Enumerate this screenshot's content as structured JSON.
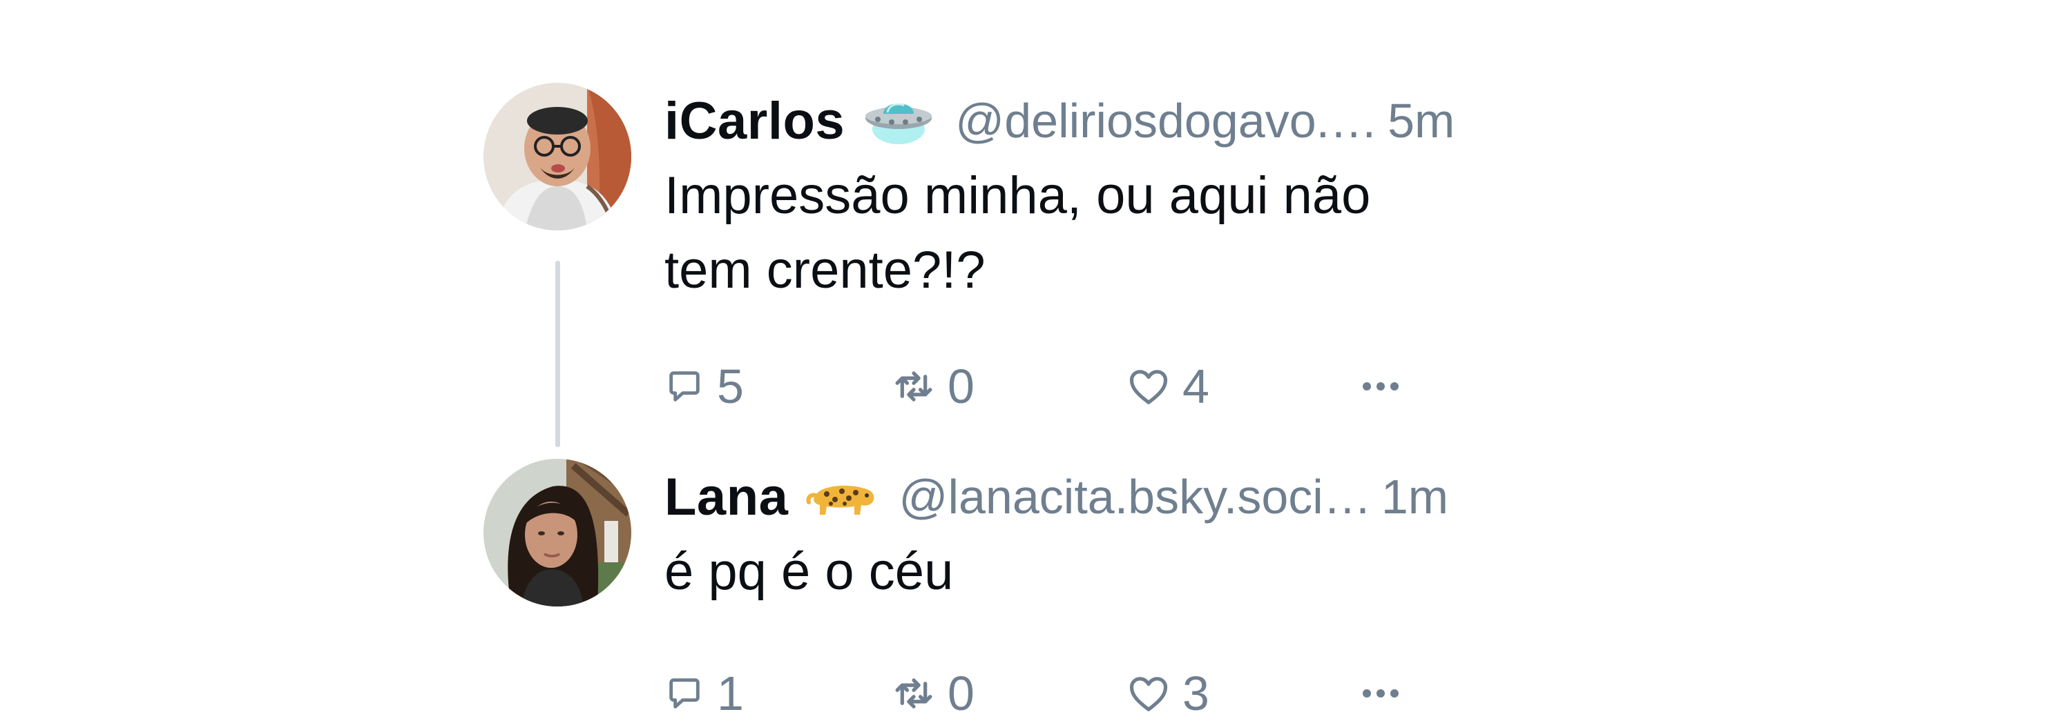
{
  "posts": [
    {
      "display_name": "iCarlos",
      "name_emoji": "flying-saucer-emoji",
      "handle": "@deliriosdogavo.…",
      "separator": "",
      "time": "5m",
      "text_lines": [
        "Impressão minha, ou aqui não",
        "tem crente?!?"
      ],
      "reply_count": "5",
      "repost_count": "0",
      "like_count": "4"
    },
    {
      "display_name": "Lana",
      "name_emoji": "leopard-emoji",
      "handle": "@lanacita.bsky.soci…",
      "separator": "",
      "time": "1m",
      "text_lines": [
        "é pq é o céu"
      ],
      "reply_count": "1",
      "repost_count": "0",
      "like_count": "3"
    }
  ],
  "colors": {
    "text": "#0b0f14",
    "muted": "#6f7f8f",
    "thread_line": "#d4d9de"
  }
}
